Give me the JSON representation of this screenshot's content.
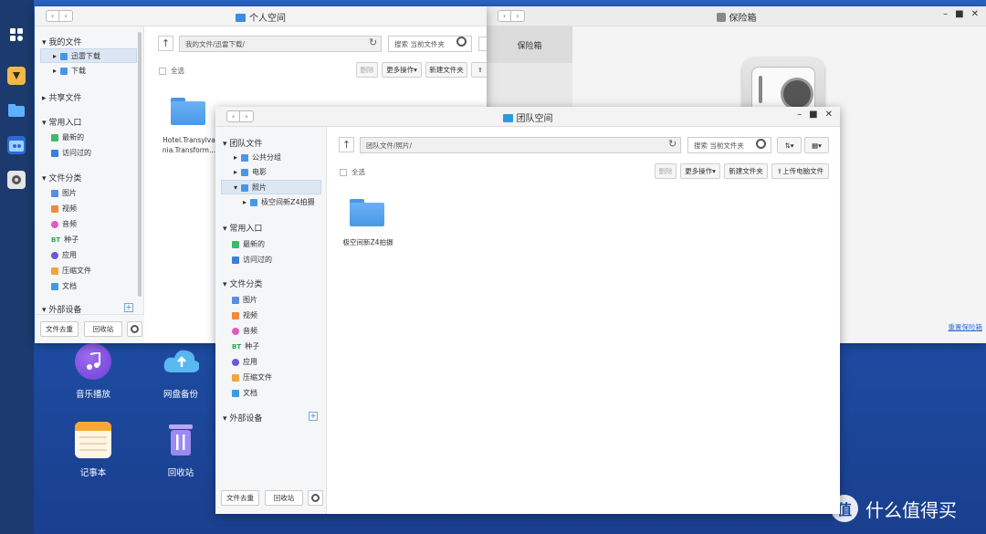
{
  "desktop": {
    "icons": [
      {
        "label": "音乐播放",
        "icon": "music-icon"
      },
      {
        "label": "网盘备份",
        "icon": "cloud-upload-icon"
      },
      {
        "label": "记事本",
        "icon": "notepad-icon"
      },
      {
        "label": "回收站",
        "icon": "trash-icon"
      }
    ],
    "watermark": "什么值得买"
  },
  "personal": {
    "title": "个人空间",
    "path": "我的文件/迅雷下载/",
    "search_placeholder": "搜索 当前文件夹",
    "select_all": "全选",
    "toolbar": {
      "delete": "删除",
      "more": "更多操作",
      "new_folder": "新建文件夹"
    },
    "sidebar": {
      "my_files": "我的文件",
      "xunlei": "迅雷下载",
      "download": "下载",
      "shared": "共享文件",
      "common": "常用入口",
      "recent": "最新的",
      "visited": "访问过的",
      "category": "文件分类",
      "cat_items": [
        "图片",
        "视频",
        "音频",
        "种子",
        "应用",
        "压缩文件",
        "文档"
      ],
      "external": "外部设备"
    },
    "file": {
      "name_line1": "Hotel.Transylva",
      "name_line2": "nia.Transform..."
    },
    "footer": {
      "dedupe": "文件去重",
      "recycle": "回收站"
    }
  },
  "vault": {
    "title": "保险箱",
    "sidebar_item": "保险箱",
    "reset_link": "重置保险箱"
  },
  "team": {
    "title": "团队空间",
    "path": "团队文件/照片/",
    "search_placeholder": "搜索 当前文件夹",
    "select_all": "全选",
    "toolbar": {
      "delete": "删除",
      "more": "更多操作",
      "new_folder": "新建文件夹",
      "upload": "上传电脑文件"
    },
    "sidebar": {
      "team_files": "团队文件",
      "public_group": "公共分组",
      "movies": "电影",
      "photos": "照片",
      "z4": "极空间新Z4拍摄",
      "common": "常用入口",
      "recent": "最新的",
      "visited": "访问过的",
      "category": "文件分类",
      "cat_items": [
        "图片",
        "视频",
        "音频",
        "种子",
        "应用",
        "压缩文件",
        "文档"
      ],
      "external": "外部设备"
    },
    "file": {
      "name": "极空间新Z4拍摄"
    },
    "footer": {
      "dedupe": "文件去重",
      "recycle": "回收站"
    }
  },
  "colors": {
    "accent": "#3b8de0",
    "taskbar": "#1c3a6e",
    "desktop": "#2a63c4"
  }
}
